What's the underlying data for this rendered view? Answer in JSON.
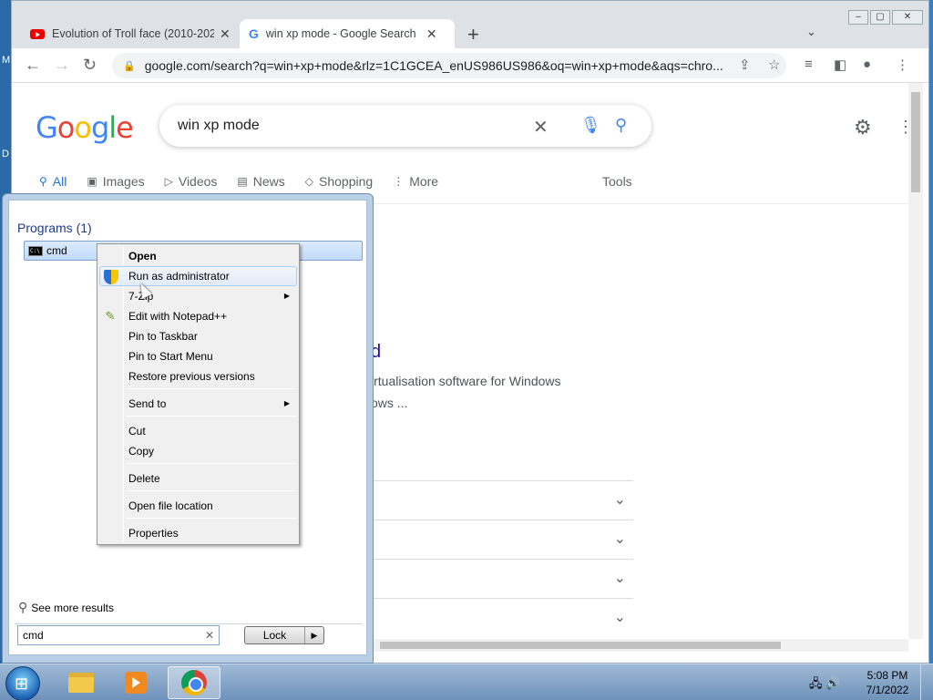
{
  "desktop": {
    "letters": [
      "M",
      "D"
    ]
  },
  "browser": {
    "tabs": [
      {
        "title": "Evolution of Troll face (2010-2022)",
        "icon": "youtube-icon",
        "close": "✕"
      },
      {
        "title": "win xp mode - Google Search",
        "icon": "google-icon",
        "close": "✕"
      }
    ],
    "new_tab": "+",
    "tab_search": "⌄",
    "window_buttons": [
      "–",
      "▢",
      "✕"
    ],
    "url": "google.com/search?q=win+xp+mode&rlz=1C1GCEA_enUS986US986&oq=win+xp+mode&aqs=chro..."
  },
  "google": {
    "logo_letters": [
      {
        "ch": "G",
        "color": "#4285f4"
      },
      {
        "ch": "o",
        "color": "#ea4335"
      },
      {
        "ch": "o",
        "color": "#fbbc05"
      },
      {
        "ch": "g",
        "color": "#4285f4"
      },
      {
        "ch": "l",
        "color": "#34a853"
      },
      {
        "ch": "e",
        "color": "#ea4335"
      }
    ],
    "query": "win xp mode",
    "tabs": [
      {
        "label": "All",
        "icon": "search-icon"
      },
      {
        "label": "Images",
        "icon": "image-icon"
      },
      {
        "label": "Videos",
        "icon": "video-icon"
      },
      {
        "label": "News",
        "icon": "news-icon"
      },
      {
        "label": "Shopping",
        "icon": "tag-icon"
      },
      {
        "label": "More",
        "icon": "more-vert-icon"
      }
    ],
    "tools": "Tools",
    "result": {
      "link_fragment": "d",
      "snippet_line1": "irtualisation software for Windows",
      "snippet_line2": "ows ..."
    }
  },
  "start_menu": {
    "heading": "Programs (1)",
    "program": "cmd",
    "see_more": "See more results",
    "search_value": "cmd",
    "clear": "✕",
    "power_button": "Lock",
    "power_arrow": "▶"
  },
  "context_menu": {
    "items": [
      {
        "label": "Open",
        "bold": true
      },
      {
        "label": "Run as administrator",
        "icon": "uac-shield-icon",
        "hover": true
      },
      {
        "label": "7-Zip",
        "submenu": true
      },
      {
        "label": "Edit with Notepad++",
        "icon": "notepad-plus-plus-icon"
      },
      {
        "label": "Pin to Taskbar"
      },
      {
        "label": "Pin to Start Menu"
      },
      {
        "label": "Restore previous versions"
      },
      {
        "label": "Send to",
        "submenu": true
      },
      {
        "label": "Cut"
      },
      {
        "label": "Copy"
      },
      {
        "label": "Delete"
      },
      {
        "label": "Open file location"
      },
      {
        "label": "Properties"
      }
    ]
  },
  "taskbar": {
    "time": "5:08 PM",
    "date": "7/1/2022",
    "pinned": [
      "windows-explorer-icon",
      "media-player-icon",
      "chrome-icon"
    ]
  }
}
